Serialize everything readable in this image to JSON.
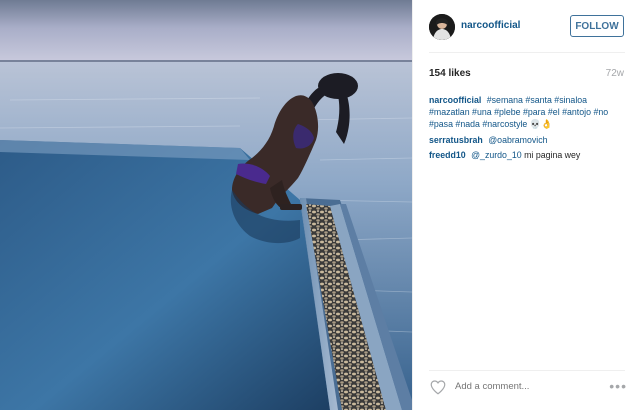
{
  "post": {
    "username": "narcoofficial",
    "follow_label": "FOLLOW",
    "likes": "154 likes",
    "age": "72w",
    "caption": {
      "user": "narcoofficial",
      "tags": [
        "#semana",
        "#santa",
        "#sinaloa",
        "#mazatlan",
        "#una",
        "#plebe",
        "#para",
        "#el",
        "#antojo",
        "#no",
        "#pasa",
        "#nada",
        "#narcostyle"
      ],
      "emoji": "💀👌"
    },
    "comments": [
      {
        "user": "serratusbrah",
        "mention": "@oabramovich",
        "text": ""
      },
      {
        "user": "freedd10",
        "mention": "@_zurdo_10",
        "text": "mi pagina wey"
      }
    ],
    "add_comment_placeholder": "Add a comment...",
    "more_label": "•••"
  },
  "icons": {
    "heart": "heart-icon",
    "more": "more-options-icon",
    "avatar": "avatar"
  },
  "colors": {
    "username": "#125688",
    "follow": "#3f729b",
    "muted": "#a5a7aa",
    "text": "#262626"
  }
}
